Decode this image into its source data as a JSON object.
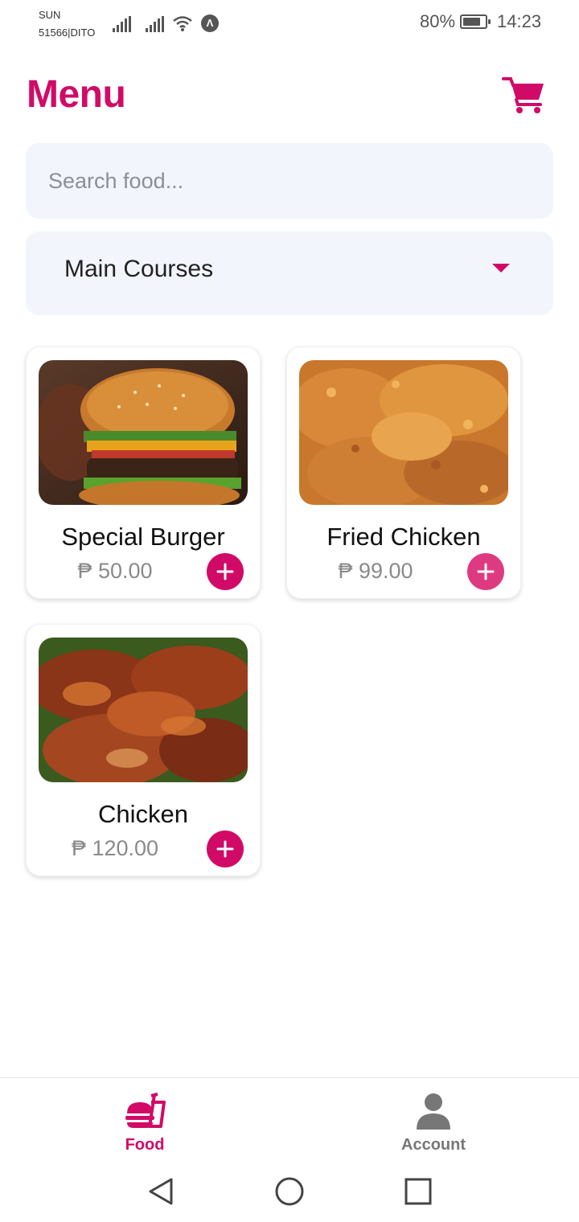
{
  "status_bar": {
    "carrier_line1": "SUN",
    "carrier_line2": "51566|DITO",
    "battery_percent": "80%",
    "battery_level": 0.8,
    "time": "14:23"
  },
  "header": {
    "title": "Menu",
    "cart_icon": "shopping-cart-icon"
  },
  "search": {
    "placeholder": "Search food...",
    "value": ""
  },
  "category_select": {
    "selected": "Main Courses"
  },
  "menu_items": [
    {
      "name": "Special Burger",
      "price": "₱ 50.00",
      "image": "burger-photo"
    },
    {
      "name": "Fried Chicken",
      "price": "₱ 99.00",
      "image": "fried-chicken-photo"
    },
    {
      "name": "Chicken",
      "price": "₱ 120.00",
      "image": "roast-chicken-photo"
    }
  ],
  "bottom_nav": {
    "items": [
      {
        "label": "Food",
        "icon": "food-icon",
        "active": true
      },
      {
        "label": "Account",
        "icon": "account-icon",
        "active": false
      }
    ]
  },
  "colors": {
    "accent": "#d10a67",
    "field_bg": "#f2f5fc",
    "muted_text": "#8a8a8a"
  }
}
